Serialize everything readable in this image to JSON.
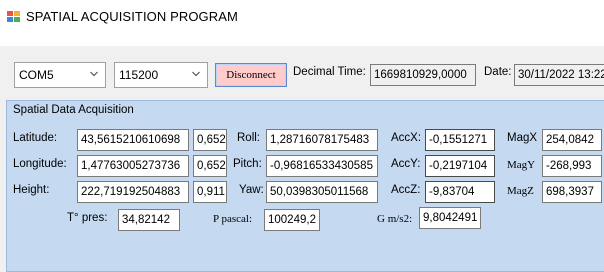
{
  "window": {
    "title": "SPATIAL ACQUISITION PROGRAM"
  },
  "connection": {
    "port": "COM5",
    "baud": "115200",
    "disconnect_label": "Disconnect",
    "decimal_time_label": "Decimal Time:",
    "decimal_time_value": "1669810929,0000",
    "date_label": "Date:",
    "date_value": "30/11/2022 13:22:0"
  },
  "group": {
    "title": "Spatial Data Acquisition",
    "latitude_label": "Latitude:",
    "latitude_value": "43,5615210610698",
    "latitude_extra": "0,652",
    "longitude_label": "Longitude:",
    "longitude_value": "1,47763005273736",
    "longitude_extra": "0,652",
    "height_label": "Height:",
    "height_value": "222,719192504883",
    "height_extra": "0,911",
    "roll_label": "Roll:",
    "roll_value": "1,28716078175483",
    "pitch_label": "Pitch:",
    "pitch_value": "-0,96816533430585",
    "yaw_label": "Yaw:",
    "yaw_value": "50,0398305011568",
    "accx_label": "AccX:",
    "accx_value": "-0,1551271",
    "accy_label": "AccY:",
    "accy_value": "-0,2197104",
    "accz_label": "AccZ:",
    "accz_value": "-9,83704",
    "magx_label": "MagX",
    "magx_value": "254,0842",
    "magy_label": "MagY",
    "magy_value": "-268,993",
    "magz_label": "MagZ",
    "magz_value": "698,3937",
    "tpres_label": "T° pres:",
    "tpres_value": "34,82142",
    "ppascal_label": "P pascal:",
    "ppascal_value": "100249,2",
    "g_label": "G m/s2:",
    "g_value": "9,8042491"
  },
  "icons": {
    "app": "app-icon",
    "dropdown": "chevron-down-icon"
  }
}
